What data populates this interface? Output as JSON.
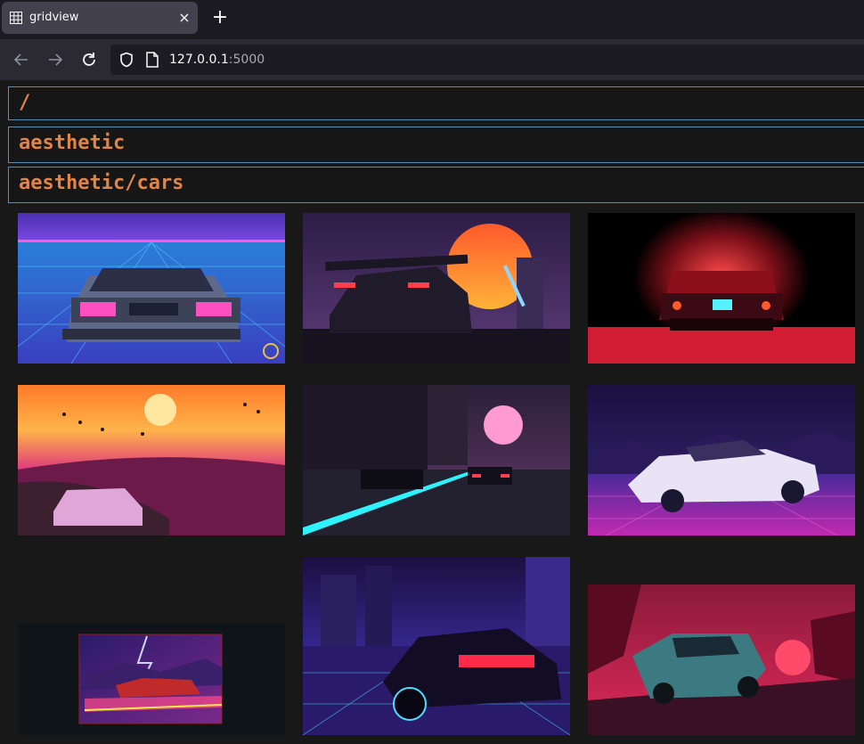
{
  "browser": {
    "tab_title": "gridview",
    "tab_close": "×",
    "new_tab": "+",
    "url_host": "127.0.0.1",
    "url_port": ":5000"
  },
  "breadcrumbs": [
    {
      "label": "/"
    },
    {
      "label": "aesthetic"
    },
    {
      "label": "aesthetic/cars"
    }
  ],
  "images": [
    {
      "name": "delorean-grid"
    },
    {
      "name": "sunset-supercar"
    },
    {
      "name": "red-ferrari-night"
    },
    {
      "name": "ferrari-hill-sunset"
    },
    {
      "name": "city-street-racers"
    },
    {
      "name": "white-testarossa"
    },
    {
      "name": "lightning-car"
    },
    {
      "name": "neon-city-car"
    },
    {
      "name": "teal-car-red-sky"
    }
  ],
  "colors": {
    "accent": "#e0844a",
    "border": "#5b8fb0",
    "page_bg": "#181818"
  }
}
